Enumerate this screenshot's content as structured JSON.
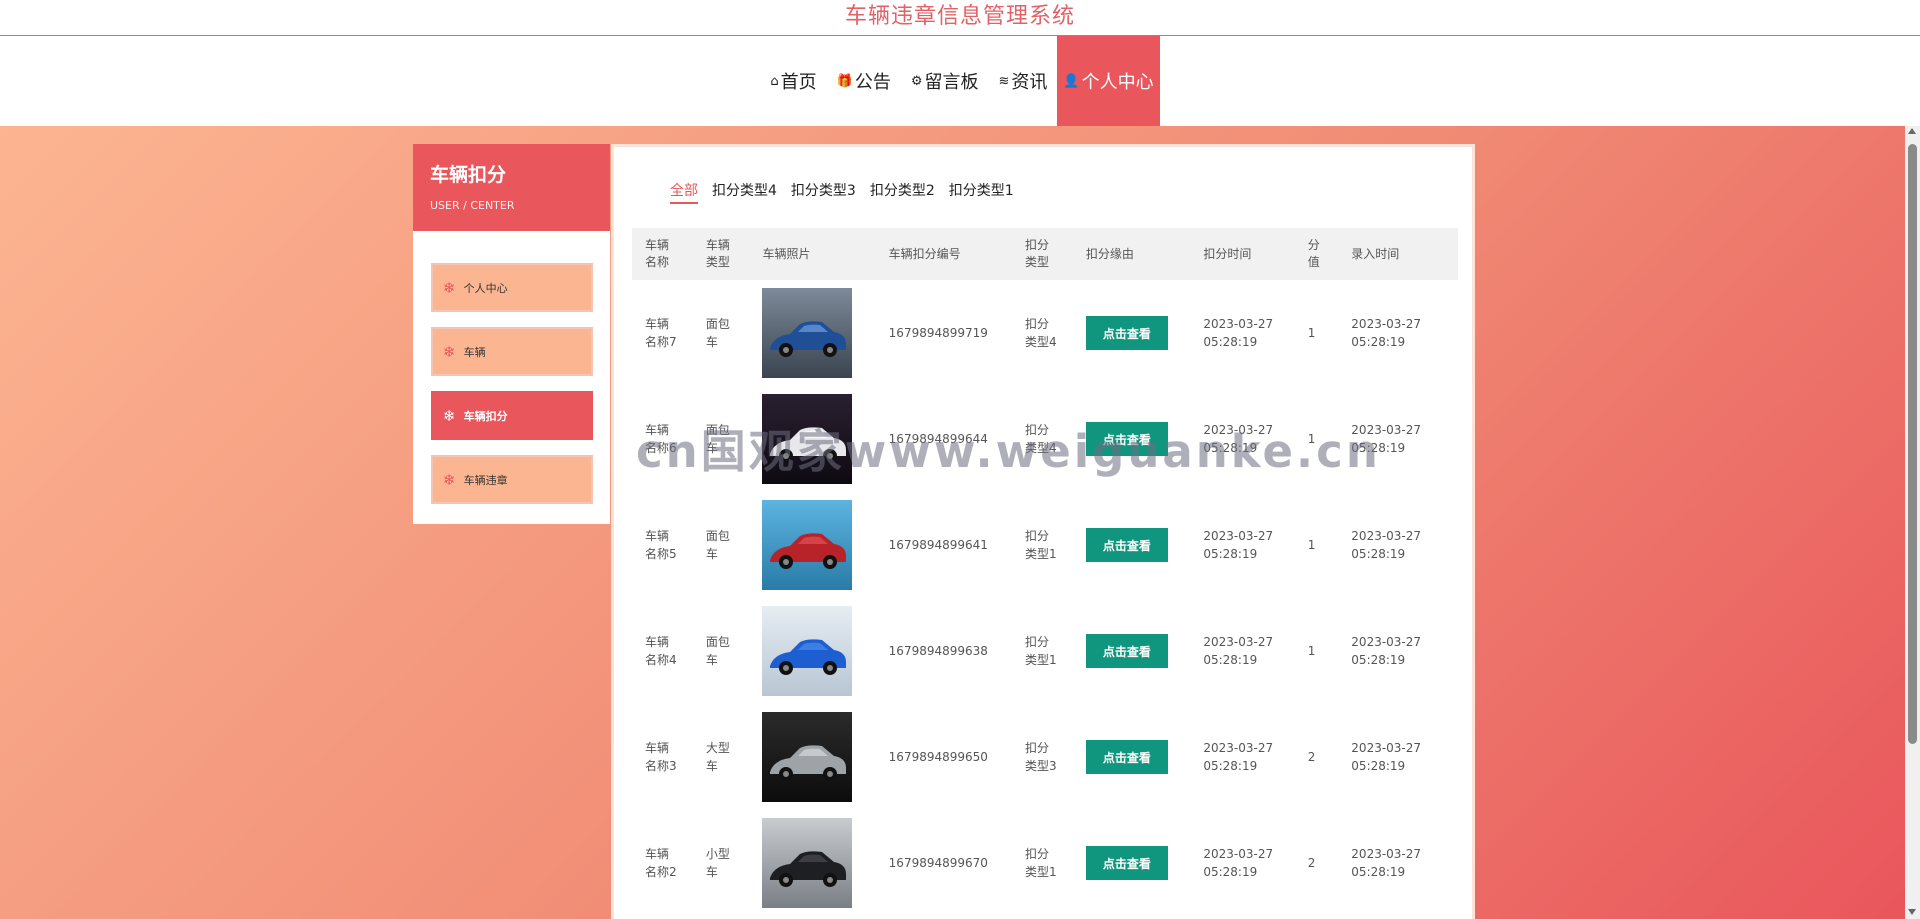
{
  "site": {
    "title": "车辆违章信息管理系统"
  },
  "nav": {
    "items": [
      {
        "icon": "home-icon",
        "glyph": "⌂",
        "label": "首页"
      },
      {
        "icon": "gift-icon",
        "glyph": "🎁",
        "label": "公告"
      },
      {
        "icon": "gear-icon",
        "glyph": "⚙",
        "label": "留言板"
      },
      {
        "icon": "layers-icon",
        "glyph": "≋",
        "label": "资讯"
      },
      {
        "icon": "user-icon",
        "glyph": "👤",
        "label": "个人中心"
      }
    ],
    "active_index": 4
  },
  "sidebar": {
    "title": "车辆扣分",
    "subtitle": "USER / CENTER",
    "items": [
      {
        "label": "个人中心",
        "glyph": "❄"
      },
      {
        "label": "车辆",
        "glyph": "❄"
      },
      {
        "label": "车辆扣分",
        "glyph": "❄"
      },
      {
        "label": "车辆违章",
        "glyph": "❄"
      }
    ],
    "active_index": 2
  },
  "tabs": {
    "items": [
      "全部",
      "扣分类型4",
      "扣分类型3",
      "扣分类型2",
      "扣分类型1"
    ],
    "active_index": 0
  },
  "table": {
    "headers": [
      "车辆名称",
      "车辆类型",
      "车辆照片",
      "车辆扣分编号",
      "扣分类型",
      "扣分缘由",
      "扣分时间",
      "分值",
      "录入时间"
    ],
    "view_button_label": "点击查看",
    "rows": [
      {
        "name": "车辆名称7",
        "type": "面包车",
        "photo": "blue-sedan",
        "number": "1679894899719",
        "deduct_type": "扣分类型4",
        "deduct_time": "2023-03-27 05:28:19",
        "score": "1",
        "entry_time": "2023-03-27 05:28:19"
      },
      {
        "name": "车辆名称6",
        "type": "面包车",
        "photo": "white-sports-car",
        "number": "1679894899644",
        "deduct_type": "扣分类型4",
        "deduct_time": "2023-03-27 05:28:19",
        "score": "1",
        "entry_time": "2023-03-27 05:28:19"
      },
      {
        "name": "车辆名称5",
        "type": "面包车",
        "photo": "red-car-lake",
        "number": "1679894899641",
        "deduct_type": "扣分类型1",
        "deduct_time": "2023-03-27 05:28:19",
        "score": "1",
        "entry_time": "2023-03-27 05:28:19"
      },
      {
        "name": "车辆名称4",
        "type": "面包车",
        "photo": "blue-sports-car",
        "number": "1679894899638",
        "deduct_type": "扣分类型1",
        "deduct_time": "2023-03-27 05:28:19",
        "score": "1",
        "entry_time": "2023-03-27 05:28:19"
      },
      {
        "name": "车辆名称3",
        "type": "大型车",
        "photo": "silver-jaguar",
        "number": "1679894899650",
        "deduct_type": "扣分类型3",
        "deduct_time": "2023-03-27 05:28:19",
        "score": "2",
        "entry_time": "2023-03-27 05:28:19"
      },
      {
        "name": "车辆名称2",
        "type": "小型车",
        "photo": "black-suv",
        "number": "1679894899670",
        "deduct_type": "扣分类型1",
        "deduct_time": "2023-03-27 05:28:19",
        "score": "2",
        "entry_time": "2023-03-27 05:28:19"
      }
    ]
  },
  "watermark": "cn国观家www.weiguanke.cn",
  "colors": {
    "primary": "#e9575c",
    "accent_button": "#10967e",
    "gradient_start": "#fcb591",
    "gradient_end": "#e9565c"
  }
}
